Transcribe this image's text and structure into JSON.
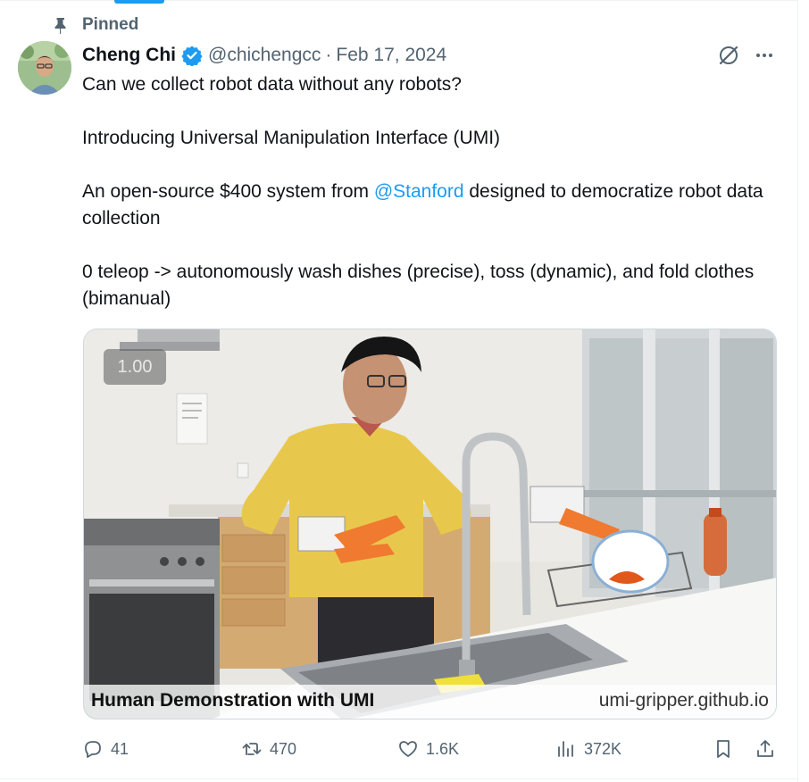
{
  "pinned_label": "Pinned",
  "author": {
    "name": "Cheng Chi",
    "handle": "@chichengcc",
    "separator": "·",
    "date": "Feb 17, 2024"
  },
  "tweet": {
    "line1": "Can we collect robot data without any robots?",
    "line2": "Introducing Universal Manipulation Interface (UMI)",
    "line3_before": "An open-source $400 system from ",
    "line3_mention": "@Stanford",
    "line3_after": " designed to democratize robot data collection",
    "line4": "0 teleop -> autonomously wash dishes (precise), toss (dynamic), and fold clothes (bimanual)"
  },
  "media": {
    "speed": "1.00",
    "caption_left": "Human Demonstration with UMI",
    "caption_right": "umi-gripper.github.io"
  },
  "actions": {
    "replies": "41",
    "reposts": "470",
    "likes": "1.6K",
    "views": "372K"
  },
  "colors": {
    "accent": "#1d9bf0",
    "secondary_text": "#536471"
  },
  "icons": [
    "pin-icon",
    "verified-badge-icon",
    "grok-icon",
    "more-icon",
    "reply-icon",
    "repost-icon",
    "like-icon",
    "views-icon",
    "bookmark-icon",
    "share-icon"
  ]
}
